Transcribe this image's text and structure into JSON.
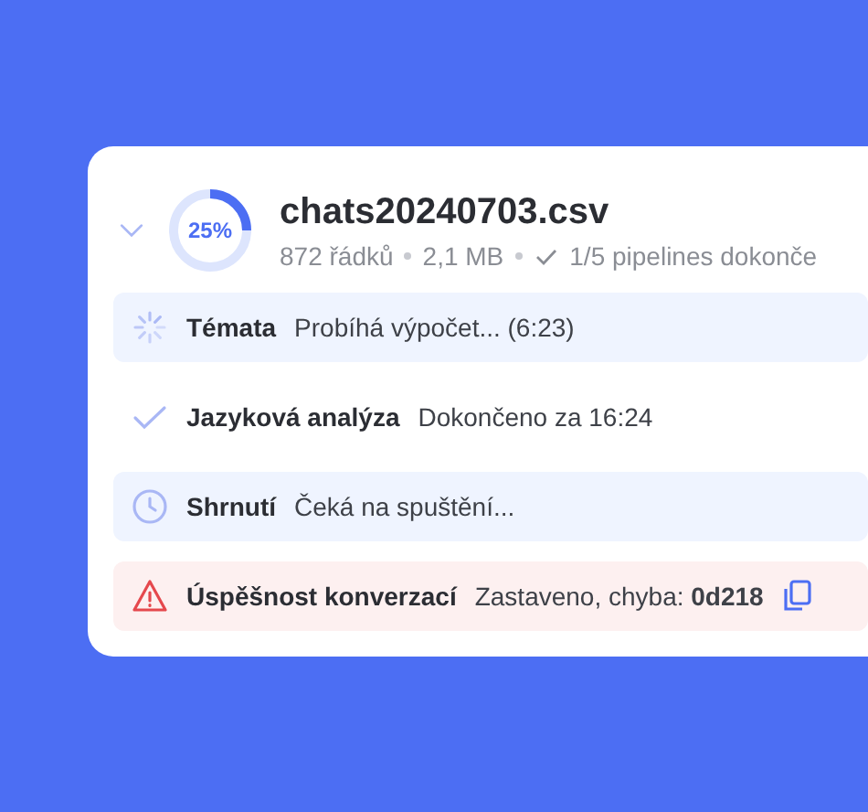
{
  "file": {
    "expanded": true,
    "progress": {
      "level": 0.25,
      "label": "25%"
    },
    "name": "chats20240703.csv",
    "meta": [
      "872 řádků",
      "2,1 MB"
    ],
    "pipelines": "1/5 pipelines dokonče"
  },
  "steps": [
    {
      "kind": "running",
      "name": "Témata",
      "status": "Probíhá výpočet... (6:23)"
    },
    {
      "kind": "done",
      "name": "Jazyková analýza",
      "status": "Dokončeno za 16:24"
    },
    {
      "kind": "waiting",
      "name": "Shrnutí",
      "status": "Čeká na spuštění..."
    },
    {
      "kind": "error",
      "name": "Úspěšnost konverzací",
      "status": "Zastaveno, chyba: **0d218**"
    }
  ]
}
